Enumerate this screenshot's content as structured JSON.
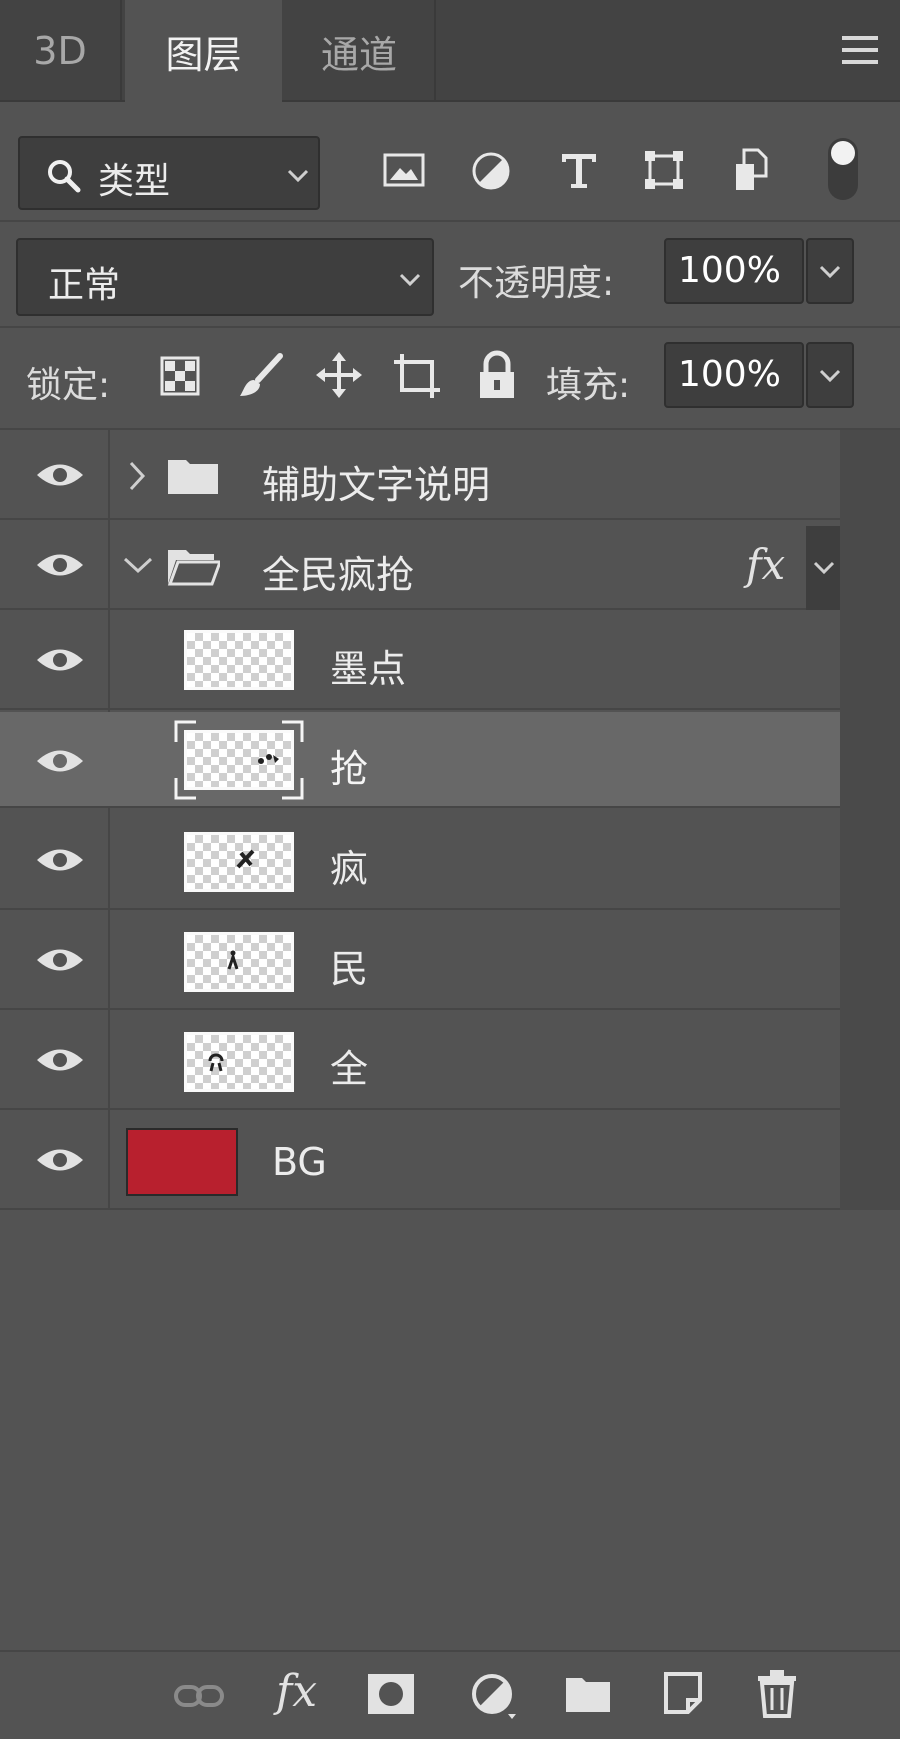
{
  "tabs": [
    {
      "label": "3D",
      "active": false
    },
    {
      "label": "图层",
      "active": true
    },
    {
      "label": "通道",
      "active": false
    }
  ],
  "filter": {
    "kind_label": "类型",
    "icons": [
      "image-filter-icon",
      "adjustment-filter-icon",
      "type-filter-icon",
      "shape-filter-icon",
      "smart-object-filter-icon",
      "filter-toggle-icon"
    ]
  },
  "blend": {
    "mode": "正常"
  },
  "opacity": {
    "label": "不透明度:",
    "value": "100%"
  },
  "lock": {
    "label": "锁定:"
  },
  "fill": {
    "label": "填充:",
    "value": "100%"
  },
  "layers": [
    {
      "name": "辅助文字说明",
      "type": "group",
      "expanded": false
    },
    {
      "name": "全民疯抢",
      "type": "group",
      "expanded": true,
      "fx": "fx"
    },
    {
      "name": "墨点",
      "type": "pixel"
    },
    {
      "name": "抢",
      "type": "pixel",
      "selected": true
    },
    {
      "name": "疯",
      "type": "pixel"
    },
    {
      "name": "民",
      "type": "pixel"
    },
    {
      "name": "全",
      "type": "pixel"
    },
    {
      "name": "BG",
      "type": "fill",
      "color": "#b8202e"
    }
  ],
  "colors": {
    "panel": "#535353",
    "tabbar": "#434343",
    "selected_row": "#686868",
    "bg_swatch": "#b8202e"
  }
}
